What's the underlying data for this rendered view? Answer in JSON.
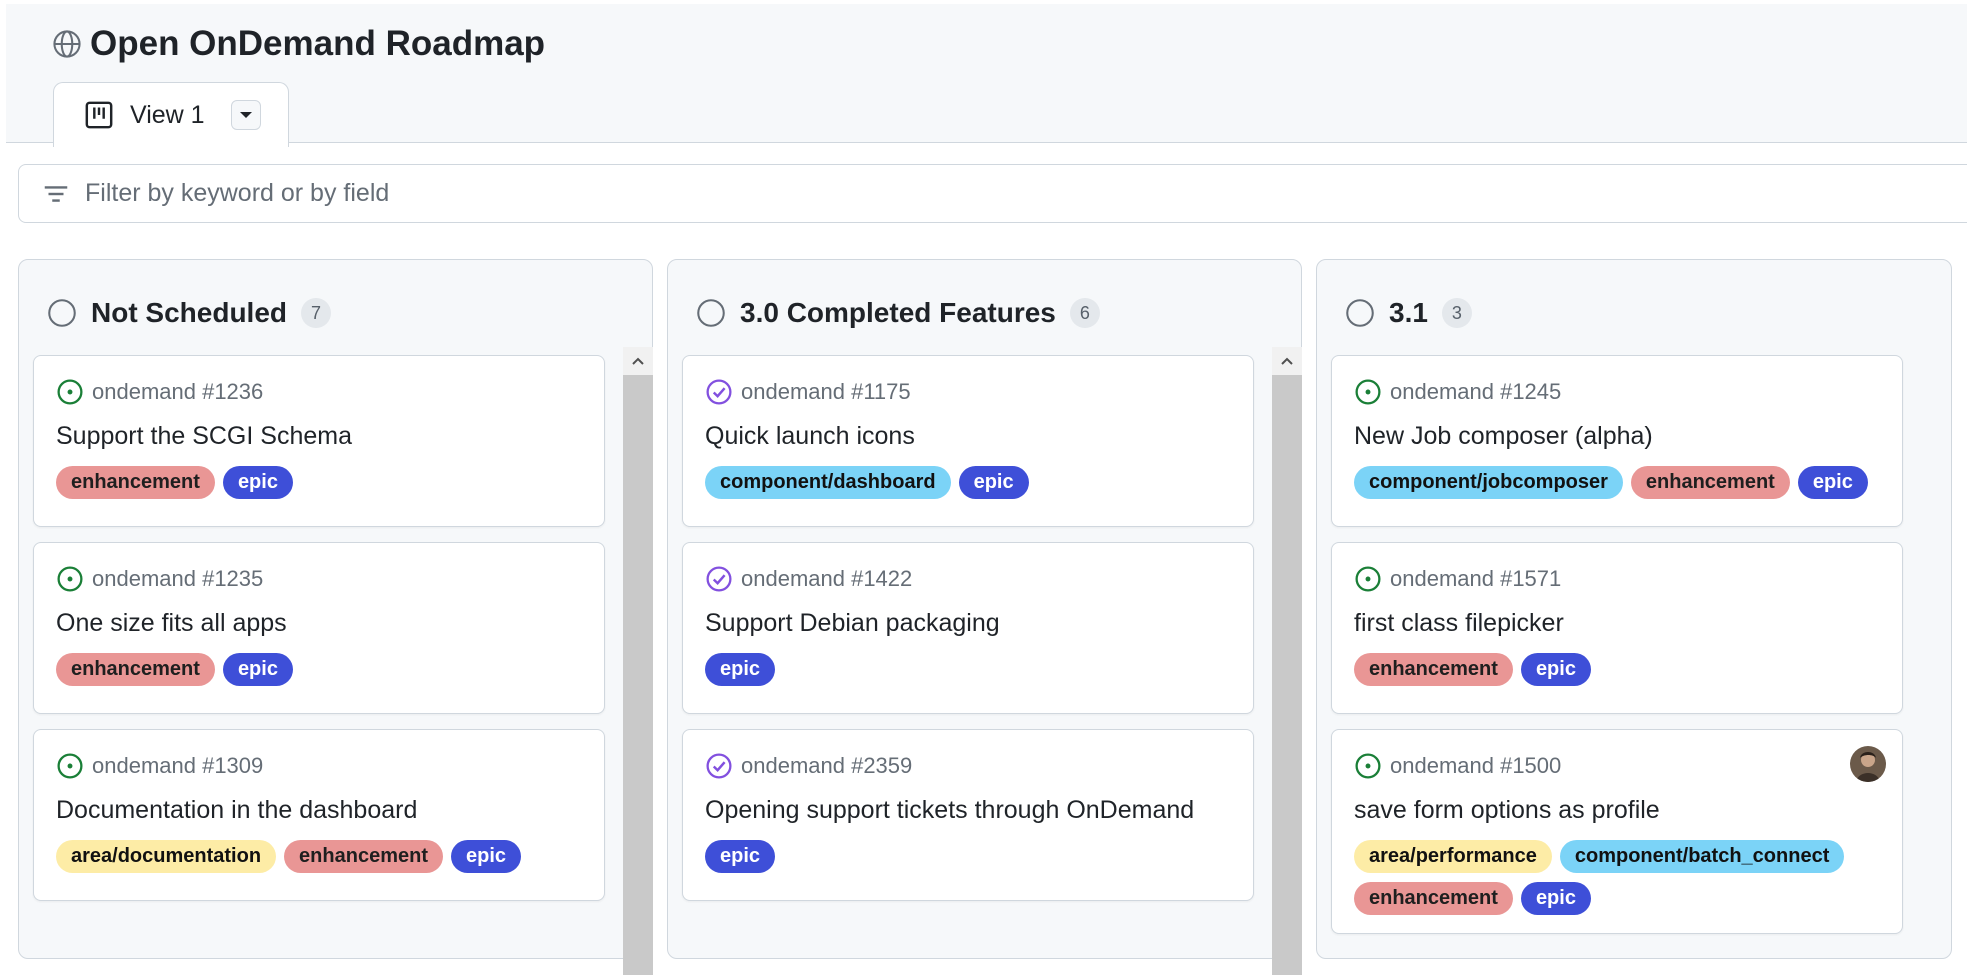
{
  "header": {
    "title": "Open OnDemand Roadmap"
  },
  "tabs": [
    {
      "label": "View 1"
    }
  ],
  "filter": {
    "placeholder": "Filter by keyword or by field"
  },
  "colors": {
    "open_issue": "#1a7f37",
    "closed_issue": "#8250df",
    "label_enhancement": "#e99695",
    "label_epic": "#3e4fd8",
    "label_component": "#7bd3f7",
    "label_area": "#fdeca6"
  },
  "columns": [
    {
      "title": "Not Scheduled",
      "count": "7",
      "cards": [
        {
          "ref": "ondemand #1236",
          "title": "Support the SCGI Schema",
          "state": "open-issue-icon",
          "labels": [
            "enhancement",
            "epic"
          ]
        },
        {
          "ref": "ondemand #1235",
          "title": "One size fits all apps",
          "state": "open-issue-icon",
          "labels": [
            "enhancement",
            "epic"
          ]
        },
        {
          "ref": "ondemand #1309",
          "title": "Documentation in the dashboard",
          "state": "open-issue-icon",
          "labels": [
            "area/documentation",
            "enhancement",
            "epic"
          ]
        }
      ]
    },
    {
      "title": "3.0 Completed Features",
      "count": "6",
      "cards": [
        {
          "ref": "ondemand #1175",
          "title": "Quick launch icons",
          "state": "closed-issue-icon",
          "labels": [
            "component/dashboard",
            "epic"
          ]
        },
        {
          "ref": "ondemand #1422",
          "title": "Support Debian packaging",
          "state": "closed-issue-icon",
          "labels": [
            "epic"
          ]
        },
        {
          "ref": "ondemand #2359",
          "title": "Opening support tickets through OnDemand",
          "state": "closed-issue-icon",
          "labels": [
            "epic"
          ]
        }
      ]
    },
    {
      "title": "3.1",
      "count": "3",
      "cards": [
        {
          "ref": "ondemand #1245",
          "title": "New Job composer (alpha)",
          "state": "open-issue-icon",
          "labels": [
            "component/jobcomposer",
            "enhancement",
            "epic"
          ]
        },
        {
          "ref": "ondemand #1571",
          "title": "first class filepicker",
          "state": "open-issue-icon",
          "labels": [
            "enhancement",
            "epic"
          ]
        },
        {
          "ref": "ondemand #1500",
          "title": "save form options as profile",
          "state": "open-issue-icon",
          "assignee": "avatar-icon",
          "labels": [
            "area/performance",
            "component/batch_connect",
            "enhancement",
            "epic"
          ]
        }
      ]
    }
  ]
}
